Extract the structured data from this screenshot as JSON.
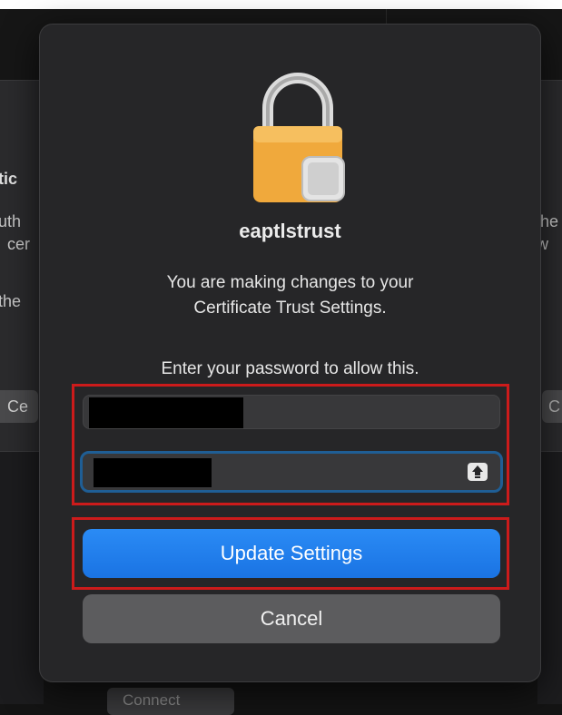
{
  "background": {
    "left_texts": [
      "tic",
      "uth",
      "cer",
      "the",
      "Ce"
    ],
    "right_texts": [
      "she",
      "tw",
      "C"
    ],
    "bottom_button": "Connect"
  },
  "dialog": {
    "icon": "lock-icon",
    "app_name": "eaptlstrust",
    "message_line1": "You are making changes to your",
    "message_line2": "Certificate Trust Settings.",
    "prompt": "Enter your password to allow this.",
    "username_value": "",
    "password_value": "",
    "caps_lock_icon": "caps-lock-icon",
    "primary_button": "Update Settings",
    "secondary_button": "Cancel"
  },
  "colors": {
    "primary_button": "#1f7ae8",
    "highlight": "#cc1b1b",
    "focus_ring": "#1f5e95"
  }
}
